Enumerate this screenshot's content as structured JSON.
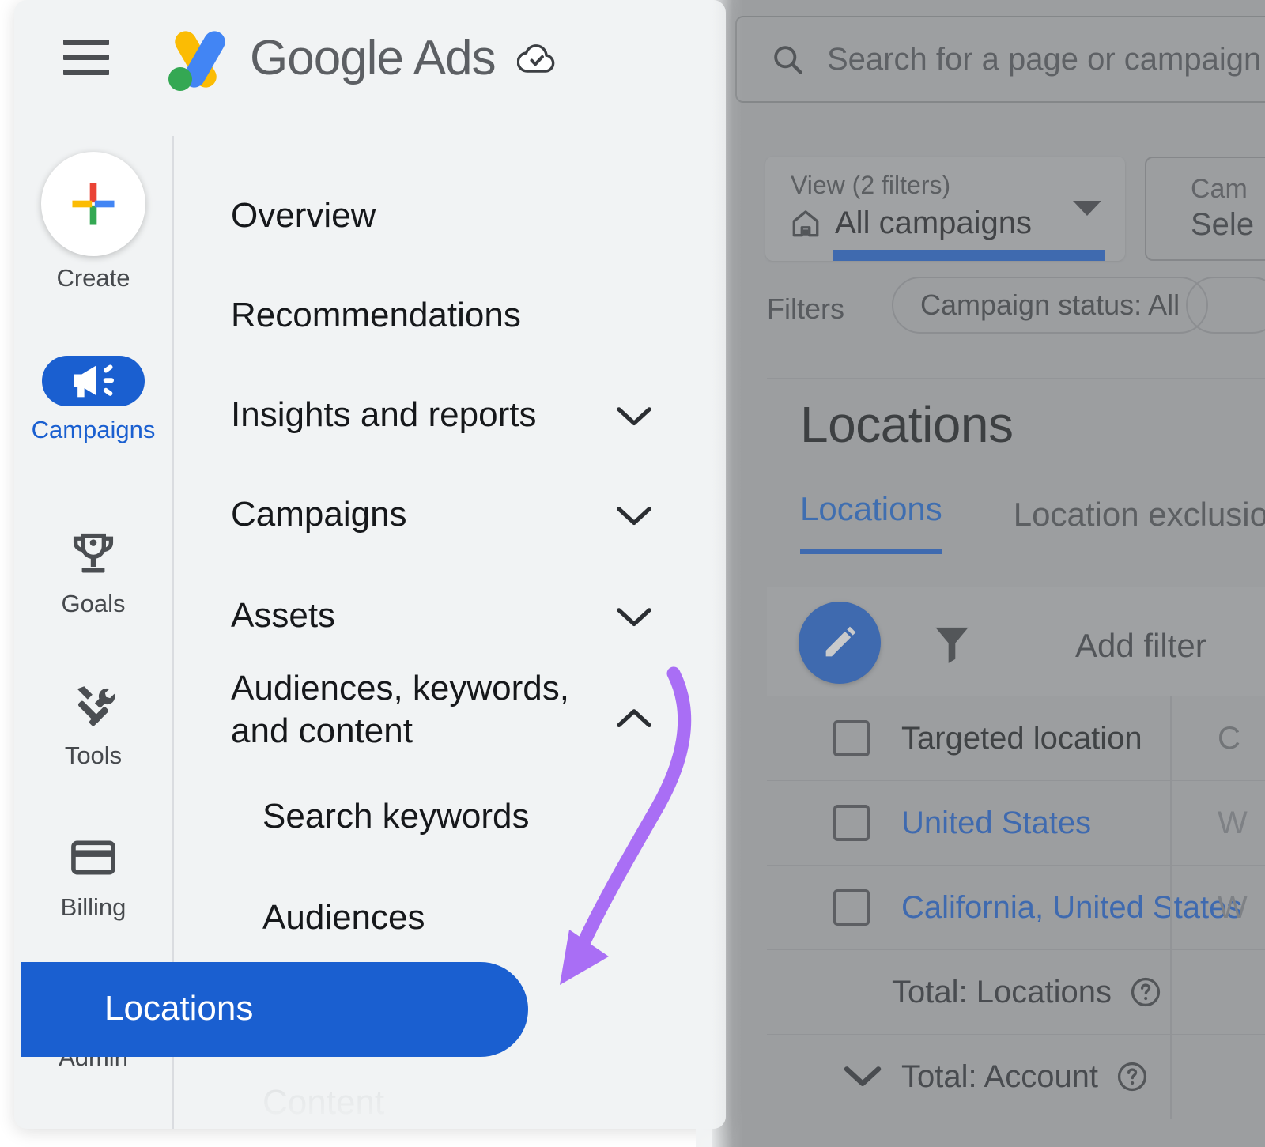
{
  "app": {
    "brand_name": "Google Ads",
    "menu_icon": "hamburger-icon",
    "logo_icon": "google-ads-logo",
    "status_icon": "cloud-check-icon"
  },
  "rail": {
    "items": [
      {
        "label": "Create",
        "icon": "plus-icon",
        "active": false
      },
      {
        "label": "Campaigns",
        "icon": "megaphone-icon",
        "active": true
      },
      {
        "label": "Goals",
        "icon": "trophy-icon",
        "active": false
      },
      {
        "label": "Tools",
        "icon": "tools-icon",
        "active": false
      },
      {
        "label": "Billing",
        "icon": "credit-card-icon",
        "active": false
      },
      {
        "label": "Admin",
        "icon": "gear-icon",
        "active": false
      }
    ]
  },
  "nav": {
    "items": [
      {
        "label": "Overview",
        "expandable": false
      },
      {
        "label": "Recommendations",
        "expandable": false
      },
      {
        "label": "Insights and reports",
        "expandable": true,
        "chevron": "chevron-down-icon"
      },
      {
        "label": "Campaigns",
        "expandable": true,
        "chevron": "chevron-down-icon"
      },
      {
        "label": "Assets",
        "expandable": true,
        "chevron": "chevron-down-icon"
      },
      {
        "label": "Audiences, keywords, and content",
        "expandable": true,
        "chevron": "chevron-up-icon"
      }
    ],
    "sub_items": [
      {
        "label": "Search keywords",
        "selected": false
      },
      {
        "label": "Audiences",
        "selected": false
      },
      {
        "label": "Locations",
        "selected": true
      },
      {
        "label": "Content",
        "selected": false
      }
    ]
  },
  "search": {
    "placeholder": "Search for a page or campaign",
    "icon": "search-icon"
  },
  "view": {
    "label": "View (2 filters)",
    "value": "All campaigns",
    "home_icon": "home-icon",
    "caret_icon": "caret-down-icon"
  },
  "campaign_selector": {
    "line1": "Cam",
    "line2": "Sele"
  },
  "filters": {
    "label": "Filters",
    "chips": [
      "Campaign status: All"
    ]
  },
  "page": {
    "title": "Locations",
    "tabs": [
      {
        "label": "Locations",
        "active": true
      },
      {
        "label": "Location exclusio",
        "active": false
      }
    ]
  },
  "toolbar": {
    "edit_icon": "pencil-icon",
    "filter_icon": "funnel-icon",
    "add_filter_label": "Add filter"
  },
  "table": {
    "columns": [
      "Targeted location",
      "C"
    ],
    "rows": [
      {
        "cells": [
          "Targeted location",
          "C"
        ],
        "header": true,
        "checkbox": true
      },
      {
        "cells": [
          "United States",
          "W"
        ],
        "header": false,
        "checkbox": true
      },
      {
        "cells": [
          "California, United States",
          "W"
        ],
        "header": false,
        "checkbox": true
      }
    ],
    "totals": [
      {
        "label": "Total: Locations",
        "help_icon": "help-icon",
        "chevron": false
      },
      {
        "label": "Total: Account",
        "help_icon": "help-icon",
        "chevron": true
      }
    ]
  },
  "annotation": {
    "arrow_color": "#a96ef5",
    "points_to": "Locations"
  },
  "colors": {
    "accent_blue": "#1a5fd0",
    "link_blue": "#1967d2",
    "panel_bg": "#f1f3f4",
    "dim_bg": "#b4b6b8"
  }
}
